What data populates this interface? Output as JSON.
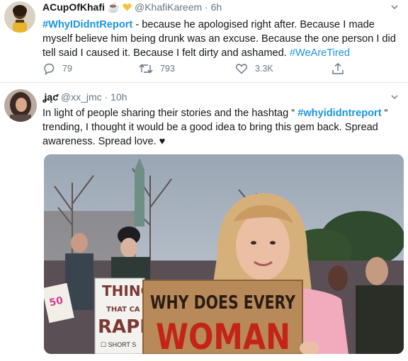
{
  "tweets": [
    {
      "name": "ACupOfKhafi",
      "emoji": "☕",
      "handle": "@KhafiKareem",
      "separator": "·",
      "time": "6h",
      "hashtag": "#WhyIDidntReport",
      "text": " - because he apologised right after. Because I made myself believe him being drunk was an excuse. Because the one person I did tell said I caused it. Because I felt dirty and ashamed. ",
      "hashtag2": "#WeAreTired",
      "actions": {
        "reply_count": "79",
        "retweet_count": "793",
        "like_count": "3.3K"
      }
    },
    {
      "name": "ʝąƈ",
      "handle": "@xx_jmc",
      "separator": "·",
      "time": "10h",
      "text_before": "In light of people sharing their stories and the hashtag “ ",
      "hashtag": "#whyididntreport",
      "text_after": " “ trending, I thought it would be a good idea to bring this gem back. Spread awareness. Spread love. ♥",
      "image": {
        "sign_line1": "WHY DOES EVERY",
        "sign_line2": "WOMAN",
        "bg_sign_line1": "THING",
        "bg_sign_line2": "THAT CA",
        "bg_sign_line3": "RAPI",
        "bg_sign_line4": "☐ SHORT S",
        "bg_sign_small": "50"
      }
    }
  ],
  "colors": {
    "link": "#1b95e0",
    "muted": "#657786",
    "divider": "#e6ecf0"
  },
  "icons": [
    "reply-icon",
    "retweet-icon",
    "like-icon",
    "share-icon",
    "chevron-down-icon",
    "heart-badge-icon"
  ]
}
